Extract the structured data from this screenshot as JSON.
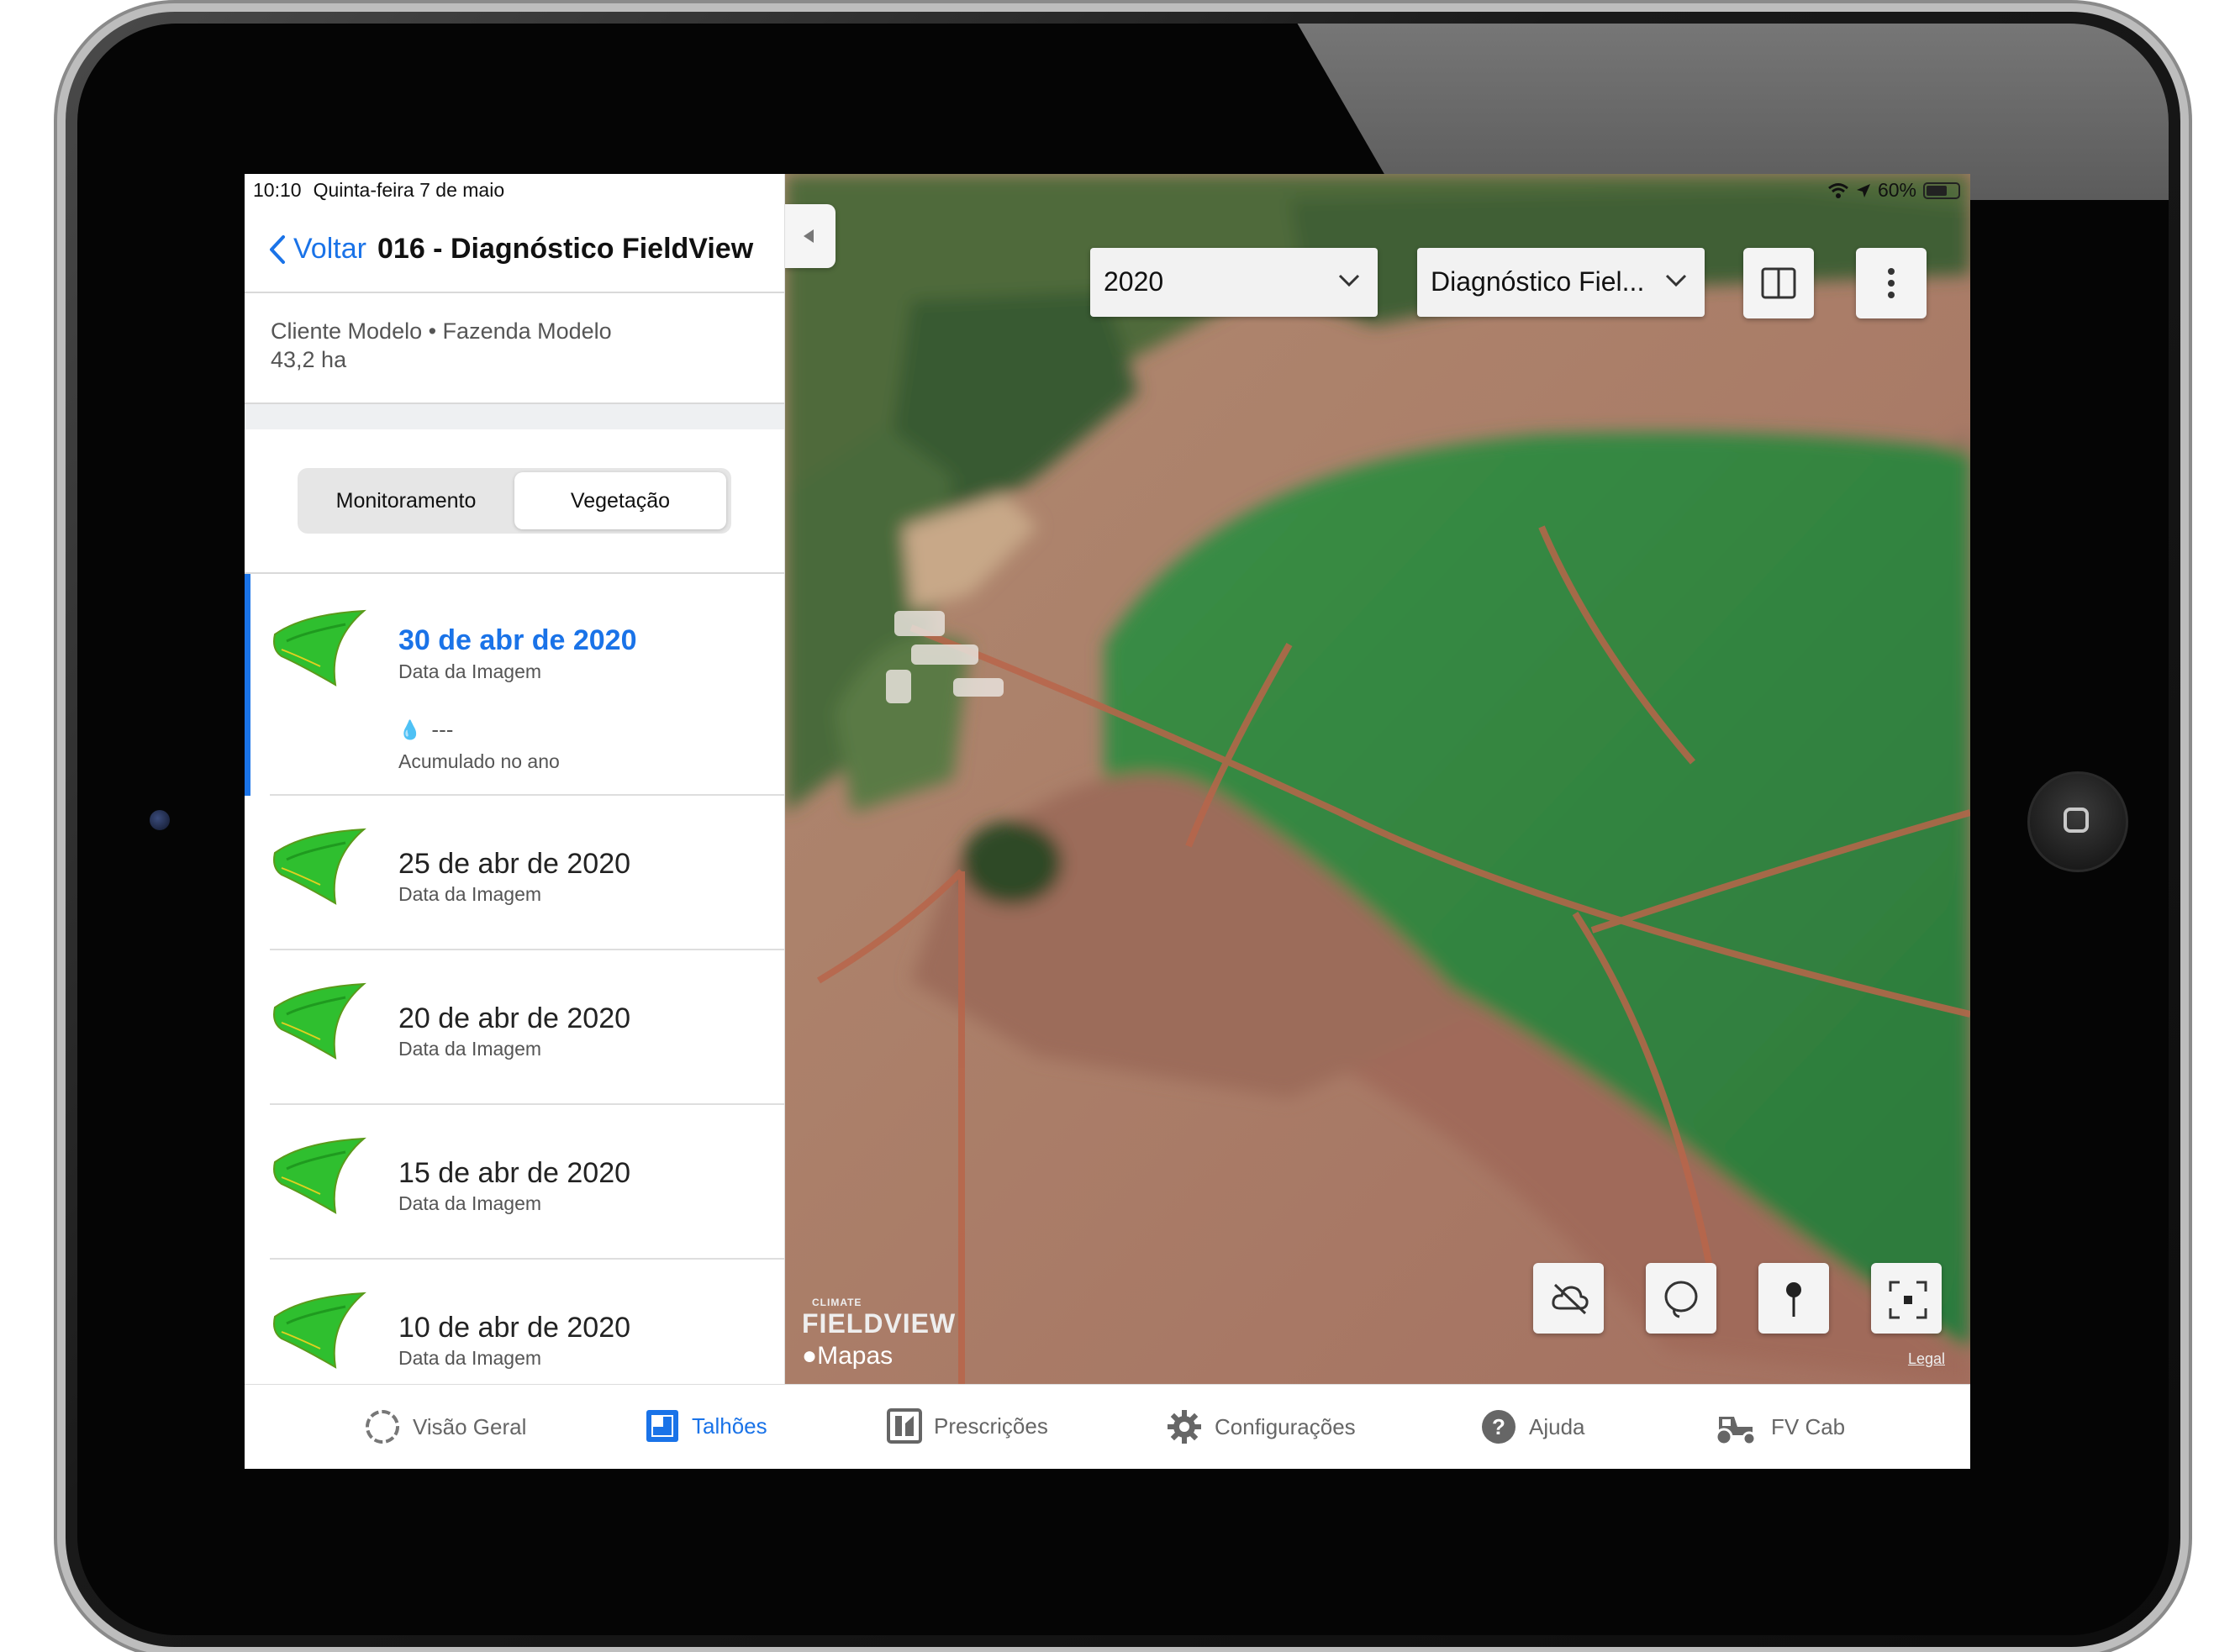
{
  "status": {
    "time": "10:10",
    "date": "Quinta-feira 7 de maio",
    "battery": "60%"
  },
  "nav": {
    "back_label": "Voltar",
    "title": "016 - Diagnóstico FieldView"
  },
  "field_info": {
    "location": "Cliente Modelo • Fazenda Modelo",
    "area": "43,2 ha"
  },
  "segmented": {
    "left": "Monitoramento",
    "right": "Vegetação",
    "selected": "Vegetação"
  },
  "list": {
    "items": [
      {
        "date": "30 de abr de 2020",
        "subtitle": "Data da Imagem",
        "rain": "---",
        "rain_label": "Acumulado no ano",
        "selected": true
      },
      {
        "date": "25 de abr de 2020",
        "subtitle": "Data da Imagem"
      },
      {
        "date": "20 de abr de 2020",
        "subtitle": "Data da Imagem"
      },
      {
        "date": "15 de abr de 2020",
        "subtitle": "Data da Imagem"
      },
      {
        "date": "10 de abr de 2020",
        "subtitle": "Data da Imagem"
      }
    ]
  },
  "map": {
    "year_dropdown": "2020",
    "layer_dropdown": "Diagnóstico Fiel...",
    "watermark_small": "CLIMATE",
    "watermark": "FIELDVIEW",
    "maps_label": "Mapas",
    "legal_label": "Legal"
  },
  "tabs": [
    {
      "label": "Visão Geral",
      "icon": "loading-circle-icon"
    },
    {
      "label": "Talhões",
      "icon": "field-icon",
      "active": true
    },
    {
      "label": "Prescrições",
      "icon": "prescription-icon"
    },
    {
      "label": "Configurações",
      "icon": "gear-icon"
    },
    {
      "label": "Ajuda",
      "icon": "help-icon"
    },
    {
      "label": "FV Cab",
      "icon": "tractor-icon"
    }
  ],
  "colors": {
    "accent": "#1a73e8",
    "field_green": "#2f8a3a",
    "soil": "#a77a63"
  }
}
